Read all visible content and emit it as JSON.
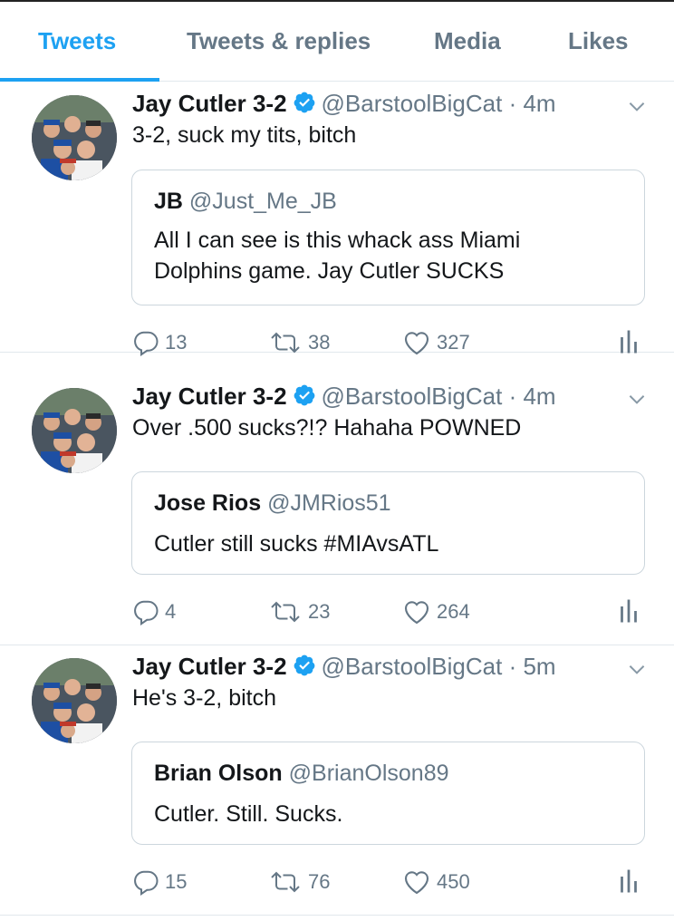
{
  "tabs": [
    {
      "label": "Tweets",
      "active": true
    },
    {
      "label": "Tweets & replies"
    },
    {
      "label": "Media"
    },
    {
      "label": "Likes"
    }
  ],
  "colors": {
    "accent": "#1da1f2",
    "muted": "#657786",
    "text": "#14171a",
    "border": "#e1e8ed"
  },
  "tweets": [
    {
      "name": "Jay Cutler 3-2",
      "handle": "@BarstoolBigCat",
      "time": "4m",
      "text": "3-2, suck my tits, bitch",
      "quote": {
        "name": "JB",
        "handle": "@Just_Me_JB",
        "lines": [
          "All I can see is this whack ass Miami",
          "Dolphins game. Jay Cutler SUCKS"
        ]
      },
      "replies": "13",
      "retweets": "38",
      "likes": "327"
    },
    {
      "name": "Jay Cutler 3-2",
      "handle": "@BarstoolBigCat",
      "time": "4m",
      "text": "Over .500 sucks?!? Hahaha POWNED",
      "quote": {
        "name": "Jose Rios",
        "handle": "@JMRios51",
        "lines": [
          "Cutler still sucks #MIAvsATL"
        ]
      },
      "replies": "4",
      "retweets": "23",
      "likes": "264"
    },
    {
      "name": "Jay Cutler 3-2",
      "handle": "@BarstoolBigCat",
      "time": "5m",
      "text": "He's 3-2, bitch",
      "quote": {
        "name": "Brian Olson",
        "handle": "@BrianOlson89",
        "lines": [
          "Cutler. Still. Sucks."
        ]
      },
      "replies": "15",
      "retweets": "76",
      "likes": "450"
    }
  ],
  "icons": {
    "verified": "verified-badge-icon",
    "caret": "chevron-down-icon",
    "reply": "reply-icon",
    "retweet": "retweet-icon",
    "like": "heart-icon",
    "analytics": "analytics-icon"
  }
}
